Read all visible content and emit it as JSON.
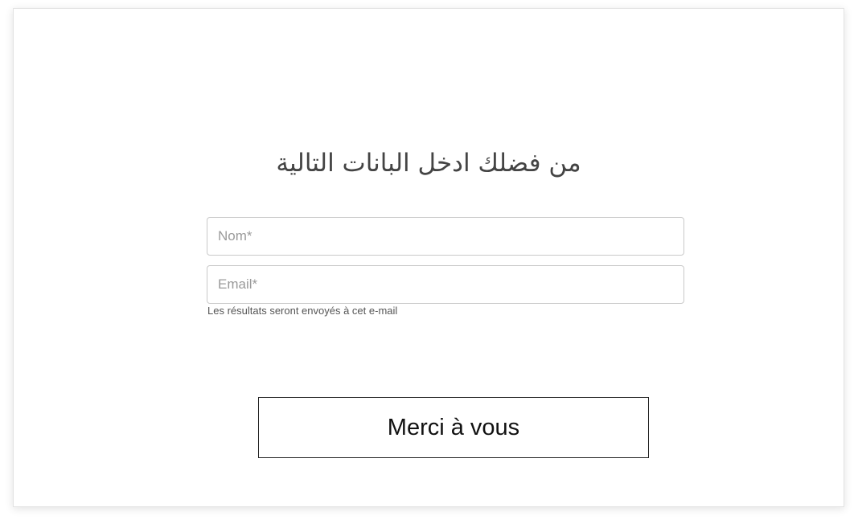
{
  "form": {
    "heading": "من فضلك ادخل البانات التالية",
    "name_field": {
      "placeholder": "Nom*",
      "value": ""
    },
    "email_field": {
      "placeholder": "Email*",
      "value": ""
    },
    "email_hint": "Les résultats seront envoyés à cet e-mail",
    "submit_label": "Merci à vous"
  },
  "colors": {
    "page_background": "#ffffff",
    "heading_text": "#444444",
    "field_border": "#c9c9c9",
    "placeholder_text": "#9a9a9a",
    "button_border": "#222222"
  }
}
